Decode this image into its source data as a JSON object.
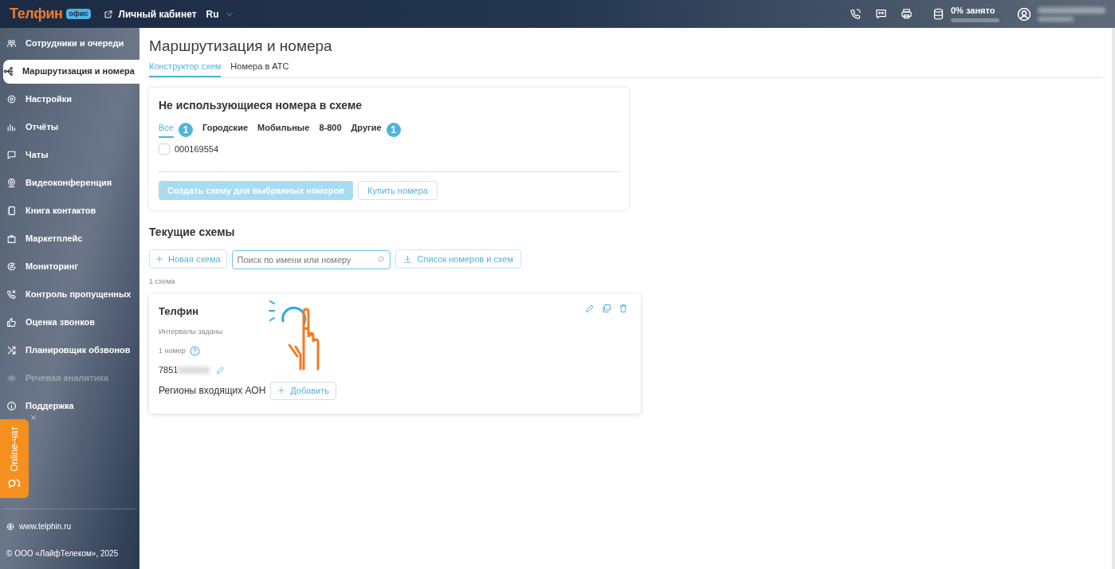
{
  "header": {
    "logo": "Телфин",
    "logo_badge": "офис",
    "cabinet_link": "Личный кабинет",
    "language": "Ru",
    "storage": {
      "label": "0% занято"
    }
  },
  "sidebar": {
    "items": [
      {
        "label": "Сотрудники и очереди",
        "selected": false,
        "disabled": false
      },
      {
        "label": "Маршрутизация и номера",
        "selected": true,
        "disabled": false
      },
      {
        "label": "Настройки",
        "selected": false,
        "disabled": false
      },
      {
        "label": "Отчёты",
        "selected": false,
        "disabled": false
      },
      {
        "label": "Чаты",
        "selected": false,
        "disabled": false
      },
      {
        "label": "Видеоконференция",
        "selected": false,
        "disabled": false
      },
      {
        "label": "Книга контактов",
        "selected": false,
        "disabled": false
      },
      {
        "label": "Маркетплейс",
        "selected": false,
        "disabled": false
      },
      {
        "label": "Мониторинг",
        "selected": false,
        "disabled": false
      },
      {
        "label": "Контроль пропущенных",
        "selected": false,
        "disabled": false
      },
      {
        "label": "Оценка звонков",
        "selected": false,
        "disabled": false
      },
      {
        "label": "Планировщик обзвонов",
        "selected": false,
        "disabled": false
      },
      {
        "label": "Речевая аналитика",
        "selected": false,
        "disabled": true
      },
      {
        "label": "Поддержка",
        "selected": false,
        "disabled": false
      }
    ],
    "chat_widget": "Online-чат",
    "website": "www.telphin.ru",
    "copyright": "© ООО «ЛайфТелеком», 2025"
  },
  "page": {
    "title": "Маршрутизация и номера",
    "tabs": [
      {
        "label": "Конструктор схем",
        "selected": true
      },
      {
        "label": "Номера в АТС",
        "selected": false
      }
    ]
  },
  "unused_numbers": {
    "title": "Не использующиеся номера в схеме",
    "filters": [
      {
        "label": "Все",
        "selected": true,
        "count": "1"
      },
      {
        "label": "Городские",
        "selected": false
      },
      {
        "label": "Мобильные",
        "selected": false
      },
      {
        "label": "8-800",
        "selected": false
      },
      {
        "label": "Другие",
        "selected": false,
        "count": "1"
      }
    ],
    "numbers": [
      {
        "number": "000169554",
        "checked": false
      }
    ],
    "create_button": {
      "label": "Создать схему для выбранных номеров",
      "disabled": true
    },
    "buy_button": "Купить номера"
  },
  "schemes": {
    "title": "Текущие схемы",
    "new_button": "Новая схема",
    "search": {
      "placeholder": "Поиск по имени или номеру"
    },
    "export_button": "Список номеров и схем",
    "count": "1 схема",
    "cards": [
      {
        "name": "Телфин",
        "intervals": "Интервалы заданы",
        "numbers_count": "1 номер",
        "number": "7851",
        "regions_label": "Регионы входящих АОН",
        "add_button": "Добавить"
      }
    ]
  }
}
